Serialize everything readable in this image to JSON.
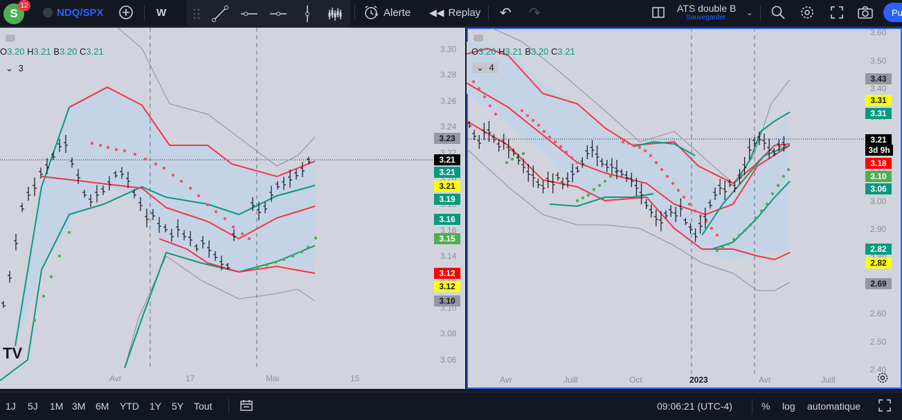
{
  "header": {
    "avatar_letter": "S",
    "notifications": "12",
    "symbol": "NDQ/SPX",
    "interval": "W",
    "alert_label": "Alerte",
    "replay_label": "Replay",
    "layout_name": "ATS double B",
    "layout_status": "Sauvegarder",
    "publish_label": "Pu"
  },
  "left_pane": {
    "ohlc": {
      "o_label": "O",
      "o": "3.20",
      "h_label": "H",
      "h": "3.21",
      "b_label": "B",
      "b": "3.20",
      "c_label": "C",
      "c": "3.21"
    },
    "indicator_count": "3",
    "y_ticks": [
      "3.30",
      "3.28",
      "3.26",
      "3.24",
      "3.22",
      "3.20",
      "3.18",
      "3.16",
      "3.14",
      "3.12",
      "3.10",
      "3.08",
      "3.06"
    ],
    "x_ticks": [
      "Avr",
      "17",
      "Mai",
      "15"
    ],
    "labels": [
      {
        "text": "3.23",
        "bg": "#9598a1",
        "fg": "#131722"
      },
      {
        "text": "3.21",
        "bg": "#000000",
        "fg": "#ffffff"
      },
      {
        "text": "3.21",
        "bg": "#089981",
        "fg": "#ffffff"
      },
      {
        "text": "3.21",
        "bg": "#ffff00",
        "fg": "#131722"
      },
      {
        "text": "3.19",
        "bg": "#089981",
        "fg": "#ffffff"
      },
      {
        "text": "3.16",
        "bg": "#089981",
        "fg": "#ffffff"
      },
      {
        "text": "3.15",
        "bg": "#4caf50",
        "fg": "#ffffff"
      },
      {
        "text": "3.12",
        "bg": "#ff0000",
        "fg": "#ffffff"
      },
      {
        "text": "3.12",
        "bg": "#ffff00",
        "fg": "#131722"
      },
      {
        "text": "3.10",
        "bg": "#9598a1",
        "fg": "#131722"
      }
    ]
  },
  "right_pane": {
    "ohlc": {
      "o_label": "O",
      "o": "3.20",
      "h_label": "H",
      "h": "3.21",
      "b_label": "B",
      "b": "3.20",
      "c_label": "C",
      "c": "3.21"
    },
    "indicator_count": "4",
    "y_ticks": [
      "3.60",
      "3.50",
      "3.40",
      "3.30",
      "3.20",
      "3.10",
      "3.00",
      "2.90",
      "2.80",
      "2.70",
      "2.60",
      "2.50",
      "2.40"
    ],
    "x_ticks": [
      "Avr",
      "Juill",
      "Oct",
      "2023",
      "Avr",
      "Juill"
    ],
    "labels": [
      {
        "text": "3.43",
        "bg": "#9598a1",
        "fg": "#131722"
      },
      {
        "text": "3.31",
        "bg": "#ffff00",
        "fg": "#131722"
      },
      {
        "text": "3.31",
        "bg": "#089981",
        "fg": "#ffffff"
      },
      {
        "text": "3.21",
        "bg": "#000000",
        "fg": "#ffffff"
      },
      {
        "text": "3d 9h",
        "bg": "#000000",
        "fg": "#ffffff"
      },
      {
        "text": "3.18",
        "bg": "#ff0000",
        "fg": "#ffffff"
      },
      {
        "text": "3.10",
        "bg": "#4caf50",
        "fg": "#ffffff"
      },
      {
        "text": "3.06",
        "bg": "#089981",
        "fg": "#ffffff"
      },
      {
        "text": "2.82",
        "bg": "#089981",
        "fg": "#ffffff"
      },
      {
        "text": "2.82",
        "bg": "#ffff00",
        "fg": "#131722"
      },
      {
        "text": "2.69",
        "bg": "#9598a1",
        "fg": "#131722"
      }
    ]
  },
  "footer": {
    "ranges": [
      "1J",
      "5J",
      "1M",
      "3M",
      "6M",
      "YTD",
      "1Y",
      "5Y",
      "Tout"
    ],
    "time": "09:06:21 (UTC-4)",
    "percent": "%",
    "log": "log",
    "auto": "automatique"
  },
  "colors": {
    "accent": "#2962ff",
    "up_band": "#089981",
    "down_band": "#f23645",
    "sar_red": "#f7525f",
    "sar_green": "#4caf50"
  }
}
